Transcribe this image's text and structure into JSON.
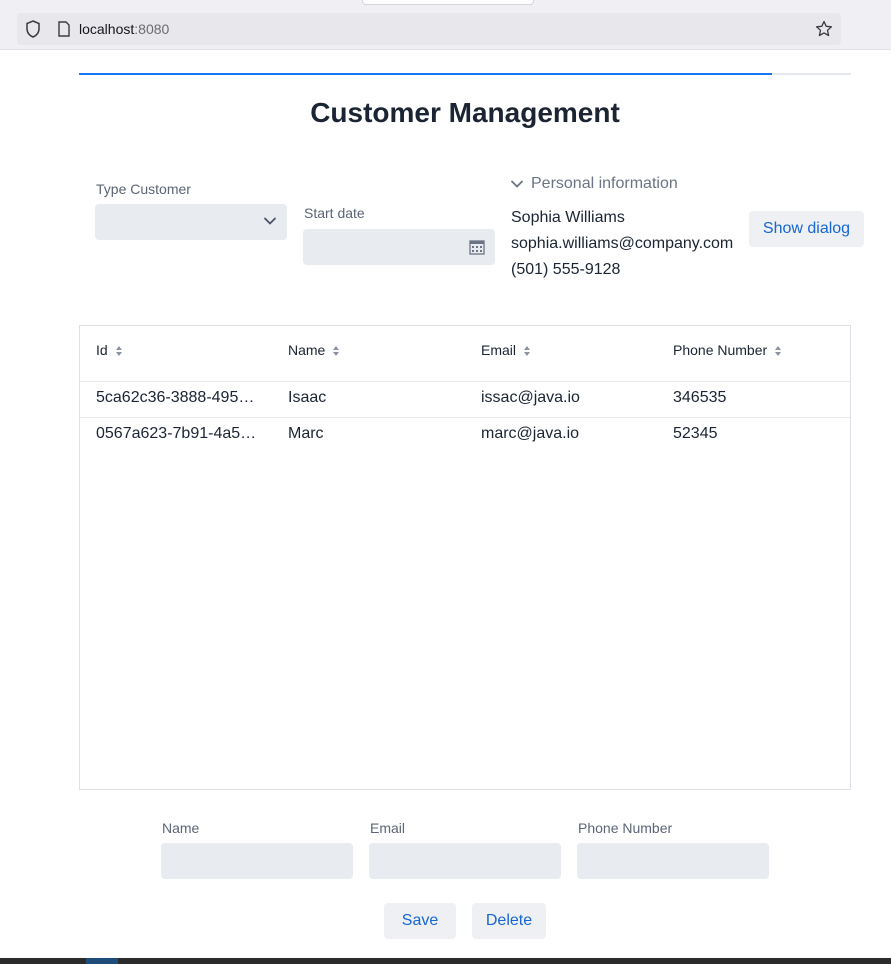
{
  "browser": {
    "url_host": "localhost",
    "url_port": ":8080"
  },
  "page": {
    "title": "Customer Management",
    "progress_fraction": 0.898
  },
  "filters": {
    "type_customer_label": "Type Customer",
    "type_customer_value": "",
    "start_date_label": "Start date",
    "start_date_value": ""
  },
  "personal_info": {
    "summary": "Personal information",
    "name": "Sophia Williams",
    "email": "sophia.williams@company.com",
    "phone": "(501) 555-9128",
    "show_dialog_label": "Show dialog"
  },
  "grid": {
    "columns": [
      "Id",
      "Name",
      "Email",
      "Phone Number"
    ],
    "rows": [
      [
        "5ca62c36-3888-495…",
        "Isaac",
        "issac@java.io",
        "346535"
      ],
      [
        "0567a623-7b91-4a5…",
        "Marc",
        "marc@java.io",
        "52345"
      ]
    ]
  },
  "form": {
    "name_label": "Name",
    "email_label": "Email",
    "phone_label": "Phone Number",
    "name_value": "",
    "email_value": "",
    "phone_value": "",
    "save_label": "Save",
    "delete_label": "Delete"
  }
}
